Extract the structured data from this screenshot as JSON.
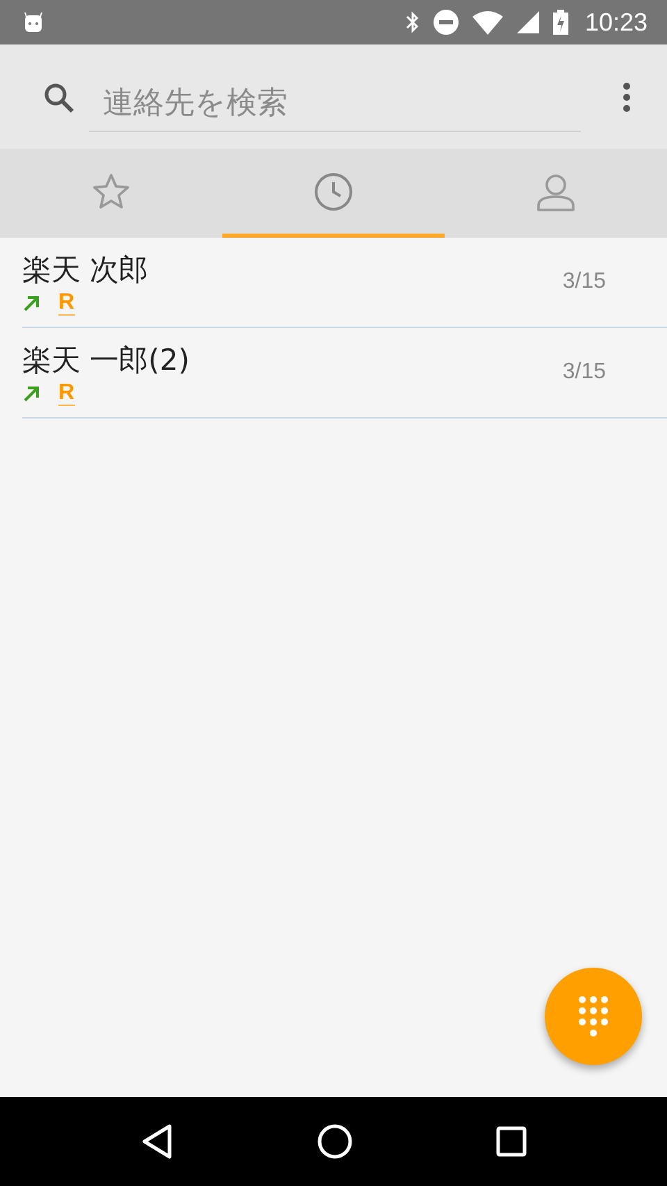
{
  "status_bar": {
    "time": "10:23"
  },
  "search": {
    "placeholder": "連絡先を検索"
  },
  "tabs": [
    {
      "kind": "favorites",
      "selected": false
    },
    {
      "kind": "recent",
      "selected": true
    },
    {
      "kind": "contacts",
      "selected": false
    }
  ],
  "calls": [
    {
      "name": "楽天 次郎",
      "kind": "outgoing",
      "service_mark": "R",
      "date": "3/15"
    },
    {
      "name": "楽天 一郎(2)",
      "kind": "outgoing",
      "service_mark": "R",
      "date": "3/15"
    }
  ]
}
